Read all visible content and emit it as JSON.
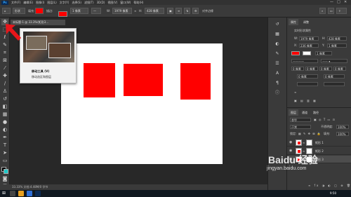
{
  "menubar": {
    "logo": "Ps",
    "items": [
      "文件(F)",
      "编辑(E)",
      "图像(I)",
      "图层(L)",
      "文字(Y)",
      "选择(S)",
      "滤镜(T)",
      "3D(D)",
      "视图(V)",
      "窗口(W)",
      "帮助(H)"
    ],
    "window_controls": [
      "—",
      "□",
      "✕"
    ]
  },
  "options_bar": {
    "fill_label": "填充:",
    "stroke_label": "描边:",
    "stroke_width": "1 像素",
    "w_label": "W:",
    "w_value": "1979 像素",
    "h_label": "H:",
    "h_value": "428 像素",
    "align_label": "对齐边缘",
    "fill_color": "#ff0000"
  },
  "document_tab": {
    "title": "未标题-1 @ 33.3%(矩形3..."
  },
  "tooltip": {
    "title": "移动工具 (V)",
    "description": "移动选区和图层"
  },
  "canvas": {
    "background": "#ffffff",
    "shape_color": "#ff0000"
  },
  "properties_panel": {
    "tabs": [
      "属性",
      "调整"
    ],
    "section_label": "实时形状属性",
    "w_label": "W:",
    "w_value": "1979 像素",
    "h_label": "H:",
    "h_value": "428 像素",
    "x_label": "X:",
    "x_value": "236 像素",
    "y_label": "Y:",
    "y_value": "1 像素",
    "stroke_value": "1 像素",
    "corner_values": [
      "0 像素",
      "0 像素",
      "0 像素",
      "0 像素"
    ],
    "radius_a": "0 像素",
    "radius_b": "0 像素"
  },
  "layers_panel": {
    "tabs": [
      "图层",
      "通道",
      "路径"
    ],
    "kind_label": "类型",
    "blend_mode": "正常",
    "opacity_label": "不透明度:",
    "opacity_value": "100%",
    "lock_label": "锁定:",
    "fill_label": "填充:",
    "fill_value": "100%",
    "layers": [
      {
        "name": "矩形 1"
      },
      {
        "name": "矩形 2"
      },
      {
        "name": "矩形 3"
      }
    ]
  },
  "status_bar": {
    "text": "33.33%    文档:4.48M/0 字节"
  },
  "taskbar": {
    "time": "9:50"
  },
  "watermark": {
    "brand": "Baidu 经验",
    "url": "jingyan.baidu.com"
  }
}
